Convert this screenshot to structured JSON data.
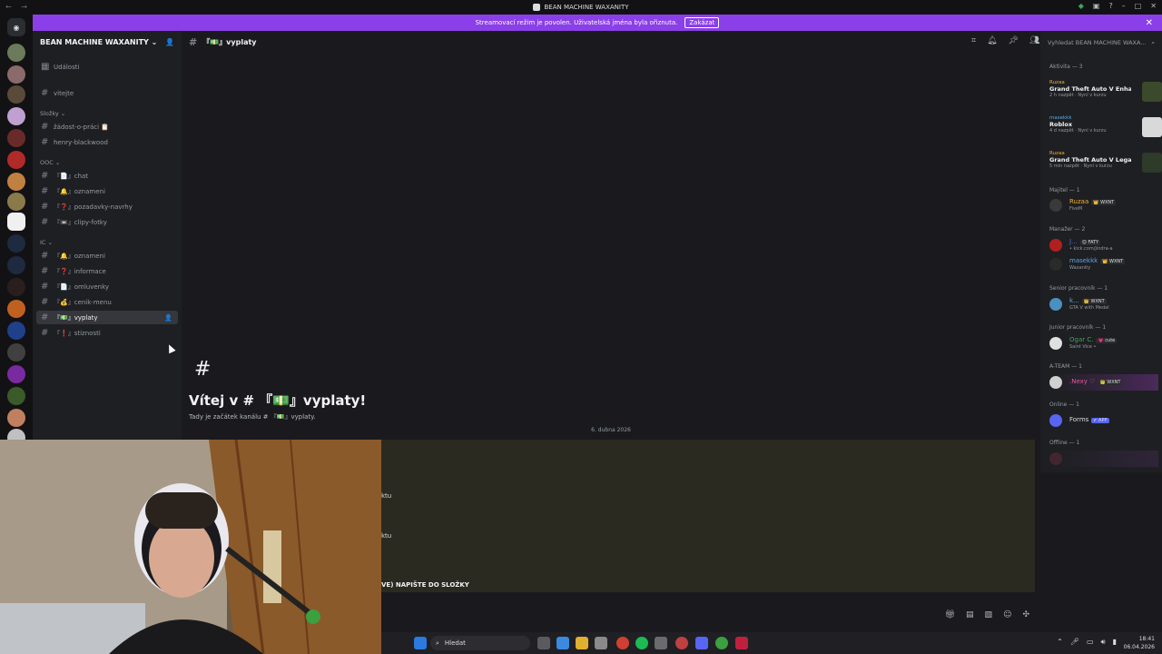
{
  "window": {
    "title": "BEAN MACHINE WAXANITY",
    "nav_arrows": "← →"
  },
  "banner": {
    "text": "Streamovací režim je povolen. Uživatelská jména byla ořiznuta.",
    "button": "Zakázat"
  },
  "server": {
    "name": "BEAN MACHINE WAXANITY",
    "events_label": "Události",
    "top_channel": "vitejte",
    "categories": [
      {
        "name": "Složky",
        "channels": [
          "žádost-o-práci 📋",
          "henry-blackwood"
        ]
      },
      {
        "name": "OOC",
        "channels": [
          "『📄』chat",
          "『🔔』oznameni",
          "『❓』pozadavky-navrhy",
          "『📼』clipy-fotky"
        ]
      },
      {
        "name": "IC",
        "channels": [
          "『🔔』oznameni",
          "『❓』informace",
          "『📄』omluvenky",
          "『💰』cenik-menu",
          "『💵』vyplaty",
          "『❗』stiznosti"
        ]
      }
    ]
  },
  "channel": {
    "name": "『💵』vyplaty",
    "welcome_title": "Vítej v # 『💵』vyplaty!",
    "welcome_sub": "Tady je začátek kanálu # 『💵』vyplaty.",
    "date_divider": "6. dubna 2026"
  },
  "messages": {
    "line1": "ktu",
    "line2": "ktu",
    "line3": "VE) NAPIŠTE DO SLOŽKY"
  },
  "members": {
    "search_placeholder": "Vyhledat BEAN MACHINE WAXA...",
    "activity_header": "Aktivita — 3",
    "activities": [
      {
        "user": "Ruzaa",
        "game": "Grand Theft Auto V Enhan...",
        "time": "2 h nazpět · Nyní v kurzu",
        "thumb": "#3a4a2a"
      },
      {
        "user": "masekkk",
        "game": "Roblox",
        "time": "4 d nazpět · Nyní v kurzu",
        "thumb": "#d9d9d9"
      },
      {
        "user": "Ruzaa",
        "game": "Grand Theft Auto V Legacy",
        "time": "5 min nazpět · Nyní v kurzu",
        "thumb": "#2e3a2a"
      }
    ],
    "groups": [
      {
        "title": "Majitel — 1",
        "rows": [
          {
            "name": "Ruzaa",
            "tag": "👑 WXNT",
            "sub": "FiveM",
            "color": "#f0b232",
            "avatar": "#3a3a3a"
          }
        ]
      },
      {
        "title": "Manažer — 2",
        "rows": [
          {
            "name": "J...",
            "tag": "😊 FATY",
            "sub": "• kick.com/jindra-a",
            "color": "#5865f2",
            "avatar": "#b02020"
          },
          {
            "name": "masekkk",
            "tag": "👑 WXNT",
            "sub": "Waxanity",
            "color": "#5aa9e6",
            "avatar": "#2a2a2a"
          }
        ]
      },
      {
        "title": "Senior pracovník — 1",
        "rows": [
          {
            "name": "k...",
            "tag": "👑 WXNT",
            "sub": "GTA V with Medal",
            "color": "#5aa9e6",
            "avatar": "#4a90c0"
          }
        ]
      },
      {
        "title": "Junior pracovník — 1",
        "rows": [
          {
            "name": "Ogar C.",
            "tag": "💗 cute",
            "sub": "Saint Vice •",
            "color": "#3ba55d",
            "avatar": "#e0e0e0"
          }
        ]
      },
      {
        "title": "A-TEAM — 1",
        "rows": [
          {
            "name": ".Nexy ♡",
            "tag": "👑 WXNT",
            "sub": "",
            "color": "#e05c9c",
            "avatar": "#d0d0d0"
          }
        ]
      },
      {
        "title": "Online — 1",
        "rows": [
          {
            "name": "Forms",
            "tag": "✔ APP",
            "sub": "",
            "color": "#dbdee1",
            "avatar": "#5865f2"
          }
        ]
      },
      {
        "title": "Offline — 1",
        "rows": [
          {
            "name": "",
            "tag": "",
            "sub": "",
            "color": "#949ba4",
            "avatar": "#5a2a38"
          }
        ]
      }
    ]
  },
  "taskbar": {
    "search": "Hledat",
    "time": "18:41",
    "date": "06.04.2026"
  },
  "colors": {
    "accent": "#8b3fe8",
    "bg": "#1a1a1e",
    "sidebar": "#1e1f22"
  }
}
